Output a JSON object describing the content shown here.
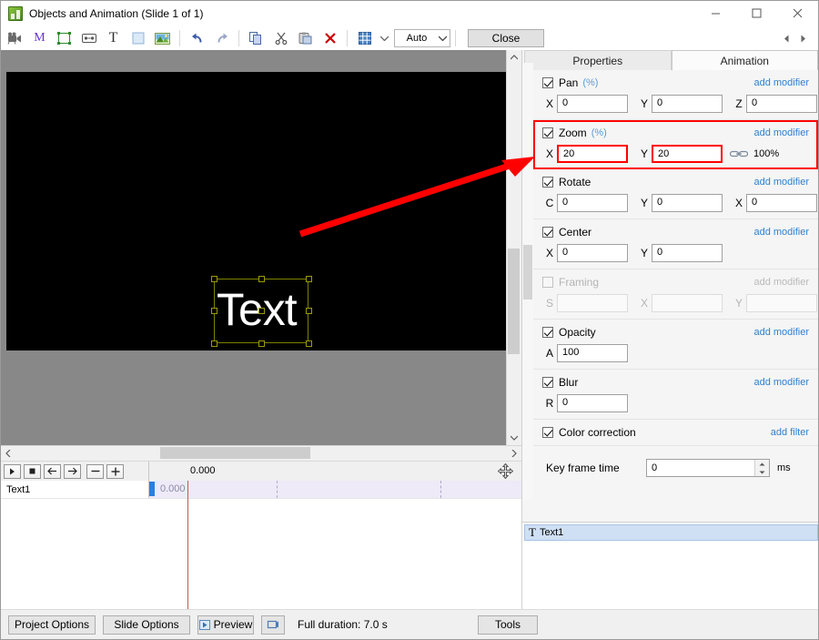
{
  "window": {
    "title": "Objects and Animation (Slide 1 of 1)",
    "app_icon": "app-icon",
    "minimize": "–",
    "maximize": "□",
    "close": "✕"
  },
  "toolbar": {
    "icons": [
      {
        "name": "video-camera-icon",
        "glyph": "🎥"
      },
      {
        "name": "mask-m-icon",
        "glyph": "M"
      },
      {
        "name": "frame-icon",
        "glyph": "▭"
      },
      {
        "name": "button-icon",
        "glyph": "⌨"
      },
      {
        "name": "text-icon",
        "glyph": "T"
      },
      {
        "name": "rectangle-icon",
        "glyph": "□"
      },
      {
        "name": "image-icon",
        "glyph": "🖼"
      },
      {
        "name": "undo-icon",
        "glyph": "↶"
      },
      {
        "name": "redo-icon",
        "glyph": "↷"
      },
      {
        "name": "copy-icon",
        "glyph": "⧉"
      },
      {
        "name": "cut-icon",
        "glyph": "✂"
      },
      {
        "name": "paste-icon",
        "glyph": "📋"
      },
      {
        "name": "delete-icon",
        "glyph": "✕"
      },
      {
        "name": "grid-icon",
        "glyph": "▦"
      }
    ],
    "zoom_combo_value": "Auto",
    "close_label": "Close",
    "nav_prev": "◀",
    "nav_next": "▶"
  },
  "canvas": {
    "object_text": "Text",
    "scroll_h": "horizontal-scrollbar",
    "scroll_v": "vertical-scrollbar"
  },
  "timeline": {
    "buttons": [
      {
        "name": "play-button",
        "glyph": "▶"
      },
      {
        "name": "stop-button",
        "glyph": "■"
      },
      {
        "name": "prev-keyframe-button",
        "glyph": "←"
      },
      {
        "name": "next-keyframe-button",
        "glyph": "→"
      },
      {
        "name": "zoom-out-button",
        "glyph": "−"
      },
      {
        "name": "zoom-in-button",
        "glyph": "+"
      }
    ],
    "ruler_time": "0.000",
    "rows": [
      {
        "name": "Text1",
        "keyframe_time": "0.000"
      }
    ],
    "move_icon": "move-tool-icon"
  },
  "right_panel": {
    "tabs": [
      {
        "label": "Properties",
        "active": false
      },
      {
        "label": "Animation",
        "active": true
      }
    ],
    "add_modifier_label": "add modifier",
    "add_filter_label": "add filter",
    "sections": [
      {
        "id": "pan",
        "title": "Pan",
        "unit": "(%)",
        "checked": true,
        "enabled": true,
        "link_label": "add modifier",
        "highlight": false,
        "fields": [
          {
            "label": "X",
            "value": "0",
            "highlight": false
          },
          {
            "label": "Y",
            "value": "0",
            "highlight": false
          },
          {
            "label": "Z",
            "value": "0",
            "highlight": false
          }
        ]
      },
      {
        "id": "zoom",
        "title": "Zoom",
        "unit": "(%)",
        "checked": true,
        "enabled": true,
        "link_label": "add modifier",
        "highlight": true,
        "fields": [
          {
            "label": "X",
            "value": "20",
            "highlight": true
          },
          {
            "label": "Y",
            "value": "20",
            "highlight": true
          }
        ],
        "link_icon": "chain-link-icon",
        "percent": "100%"
      },
      {
        "id": "rotate",
        "title": "Rotate",
        "unit": "",
        "checked": true,
        "enabled": true,
        "link_label": "add modifier",
        "highlight": false,
        "fields": [
          {
            "label": "C",
            "value": "0",
            "highlight": false
          },
          {
            "label": "Y",
            "value": "0",
            "highlight": false
          },
          {
            "label": "X",
            "value": "0",
            "highlight": false
          }
        ]
      },
      {
        "id": "center",
        "title": "Center",
        "unit": "",
        "checked": true,
        "enabled": true,
        "link_label": "add modifier",
        "highlight": false,
        "fields": [
          {
            "label": "X",
            "value": "0",
            "highlight": false
          },
          {
            "label": "Y",
            "value": "0",
            "highlight": false
          }
        ]
      },
      {
        "id": "framing",
        "title": "Framing",
        "unit": "",
        "checked": false,
        "enabled": false,
        "link_label": "add modifier",
        "highlight": false,
        "fields": [
          {
            "label": "S",
            "value": "",
            "highlight": false
          },
          {
            "label": "X",
            "value": "",
            "highlight": false
          },
          {
            "label": "Y",
            "value": "",
            "highlight": false
          }
        ]
      },
      {
        "id": "opacity",
        "title": "Opacity",
        "unit": "",
        "checked": true,
        "enabled": true,
        "link_label": "add modifier",
        "highlight": false,
        "fields": [
          {
            "label": "A",
            "value": "100",
            "highlight": false
          }
        ]
      },
      {
        "id": "blur",
        "title": "Blur",
        "unit": "",
        "checked": true,
        "enabled": true,
        "link_label": "add modifier",
        "highlight": false,
        "fields": [
          {
            "label": "R",
            "value": "0",
            "highlight": false
          }
        ]
      },
      {
        "id": "color-correction",
        "title": "Color correction",
        "unit": "",
        "checked": true,
        "enabled": true,
        "link_label": "add filter",
        "highlight": false,
        "fields": []
      }
    ],
    "key_frame_time": {
      "label": "Key frame time",
      "value": "0",
      "unit": "ms"
    },
    "object_list": [
      {
        "icon": "text-object-icon",
        "label": "Text1"
      }
    ]
  },
  "bottom_bar": {
    "project_options": "Project Options",
    "slide_options": "Slide Options",
    "preview": "Preview",
    "loop_icon": "loop-icon",
    "duration_text": "Full duration: 7.0 s",
    "tools": "Tools"
  },
  "annotation": {
    "color": "#ff0000",
    "description": "red-arrow-pointing-to-zoom-fields"
  }
}
